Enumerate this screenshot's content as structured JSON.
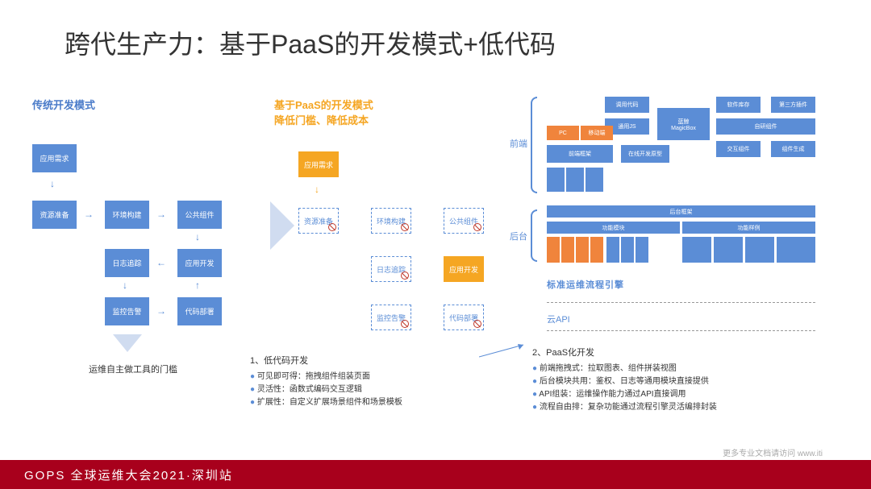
{
  "title": "跨代生产力：基于PaaS的开发模式+低代码",
  "sec1": {
    "title": "传统开发模式",
    "a": "应用需求",
    "b": "资源准备",
    "c": "环境构建",
    "d": "公共组件",
    "e": "日志追踪",
    "f": "应用开发",
    "g": "监控告警",
    "h": "代码部署",
    "caption": "运维自主做工具的门槛"
  },
  "sec2": {
    "title": "基于PaaS的开发模式\n降低门槛、降低成本",
    "a": "应用需求",
    "b": "资源准备",
    "c": "环境构建",
    "d": "公共组件",
    "e": "日志追踪",
    "f": "应用开发",
    "g": "监控告警",
    "h": "代码部署"
  },
  "sec3": {
    "front_label": "前端",
    "back_label": "后台",
    "fb": {
      "a": "调用代码",
      "b": "通用JS",
      "c": "软件库存",
      "d": "第三方插件",
      "e": "PC",
      "f": "移动端",
      "g": "前端框架",
      "h": "蓝鲸\nMagicBox",
      "i": "自研组件",
      "j": "在线开发原型",
      "k": "交互组件",
      "l": "组件生成"
    },
    "back": {
      "title": "后台框架",
      "a": "功能模块",
      "b": "功能样例"
    },
    "engine": "标准运维流程引擎",
    "cloud": "云API"
  },
  "note1": {
    "title": "1、低代码开发",
    "l1": "可见即可得：拖拽组件组装页面",
    "l2": "灵活性：函数式编码交互逻辑",
    "l3": "扩展性：自定义扩展场景组件和场景模板"
  },
  "note2": {
    "title": "2、PaaS化开发",
    "l1": "前端拖拽式：拉取图表、组件拼装视图",
    "l2": "后台模块共用：鉴权、日志等通用模块直接提供",
    "l3": "API组装：运维操作能力通过API直接调用",
    "l4": "流程自由排：复杂功能通过流程引擎灵活编排封装"
  },
  "footer": "GOPS 全球运维大会2021·深圳站",
  "footnote": "更多专业文档请访问 www.iti"
}
